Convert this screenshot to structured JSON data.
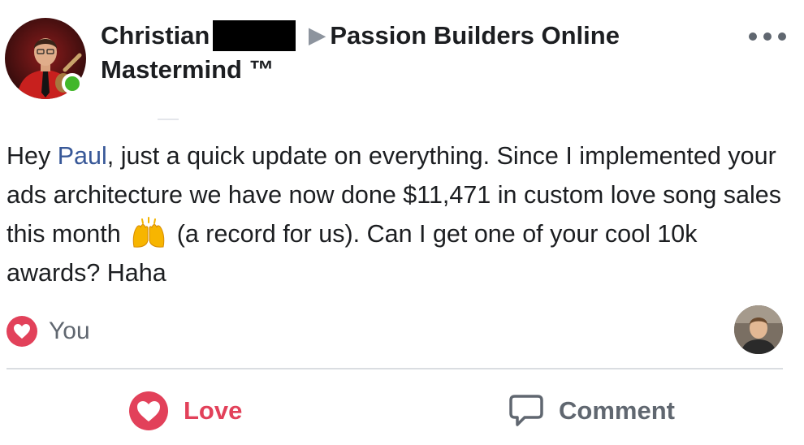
{
  "post": {
    "author": {
      "name": "Christian",
      "online": true
    },
    "group": "Passion Builders Online Mastermind ™",
    "header_arrow": "▶",
    "message": {
      "greeting": "Hey ",
      "mention": "Paul",
      "line_rest": ", just a quick update on everything. Since I implemented your ads architecture we have now done $11,471 in custom love song sales this month",
      "emoji": "raising-hands-emoji",
      "ending": " (a record for us). Can I get one of your cool 10k awards? Haha"
    },
    "reaction": {
      "type": "love",
      "label": "You"
    },
    "actions": {
      "love_label": "Love",
      "comment_label": "Comment"
    }
  },
  "colors": {
    "love": "#e2415a",
    "mention": "#385898",
    "online": "#42b72a",
    "muted": "#606770"
  }
}
